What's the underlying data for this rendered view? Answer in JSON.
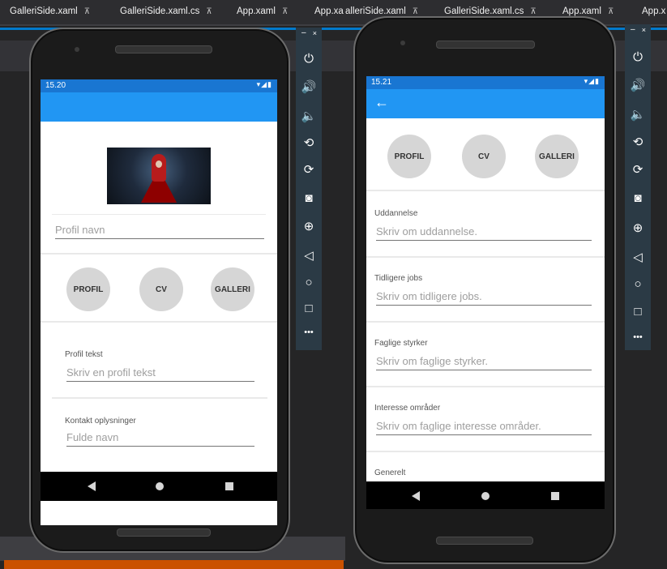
{
  "left_ide": {
    "tabs": [
      {
        "label": "GalleriSide.xaml",
        "pin": "⊼"
      },
      {
        "label": "GalleriSide.xaml.cs",
        "pin": "⊼"
      },
      {
        "label": "App.xaml",
        "pin": "⊼"
      },
      {
        "label": "App.xa",
        "pin": ""
      }
    ]
  },
  "right_ide": {
    "tabs": [
      {
        "label": "alleriSide.xaml",
        "pin": "⊼"
      },
      {
        "label": "GalleriSide.xaml.cs",
        "pin": "⊼"
      },
      {
        "label": "App.xaml",
        "pin": "⊼"
      },
      {
        "label": "App.x",
        "pin": ""
      }
    ]
  },
  "toolbar": {
    "minimize": "–",
    "close": "×",
    "icons": [
      {
        "name": "power-icon",
        "glyph": "⏻"
      },
      {
        "name": "volume-up-icon",
        "glyph": "🔊"
      },
      {
        "name": "volume-down-icon",
        "glyph": "🔈"
      },
      {
        "name": "rotate-left-icon",
        "glyph": "⟲"
      },
      {
        "name": "rotate-right-icon",
        "glyph": "⟳"
      },
      {
        "name": "camera-icon",
        "glyph": "◙"
      },
      {
        "name": "zoom-icon",
        "glyph": "⊕"
      },
      {
        "name": "back-icon",
        "glyph": "◁"
      },
      {
        "name": "home-icon",
        "glyph": "○"
      },
      {
        "name": "overview-icon",
        "glyph": "□"
      },
      {
        "name": "more-icon",
        "glyph": "•••"
      }
    ]
  },
  "phone1": {
    "status_time": "15.20",
    "status_icons": "▾◢▮",
    "profile_name_placeholder": "Profil navn",
    "nav_buttons": [
      "PROFIL",
      "CV",
      "GALLERI"
    ],
    "profile_text_label": "Profil tekst",
    "profile_text_placeholder": "Skriv en profil tekst",
    "contact_label": "Kontakt oplysninger",
    "full_name_placeholder": "Fulde navn"
  },
  "phone2": {
    "status_time": "15.21",
    "status_icons": "▾◢▮",
    "back_glyph": "←",
    "nav_buttons": [
      "PROFIL",
      "CV",
      "GALLERI"
    ],
    "sections": [
      {
        "label": "Uddannelse",
        "placeholder": "Skriv om uddannelse."
      },
      {
        "label": "Tidligere jobs",
        "placeholder": "Skriv om tidligere jobs."
      },
      {
        "label": "Faglige styrker",
        "placeholder": "Skriv om faglige styrker."
      },
      {
        "label": "Interesse områder",
        "placeholder": "Skriv om faglige interesse områder."
      }
    ],
    "last_label": "Generelt"
  },
  "colors": {
    "status_bar": "#1976d2",
    "app_bar": "#2196f3",
    "button_circle": "#d6d6d6",
    "ide_accent": "#007acc",
    "ide_orange": "#ca5100"
  }
}
